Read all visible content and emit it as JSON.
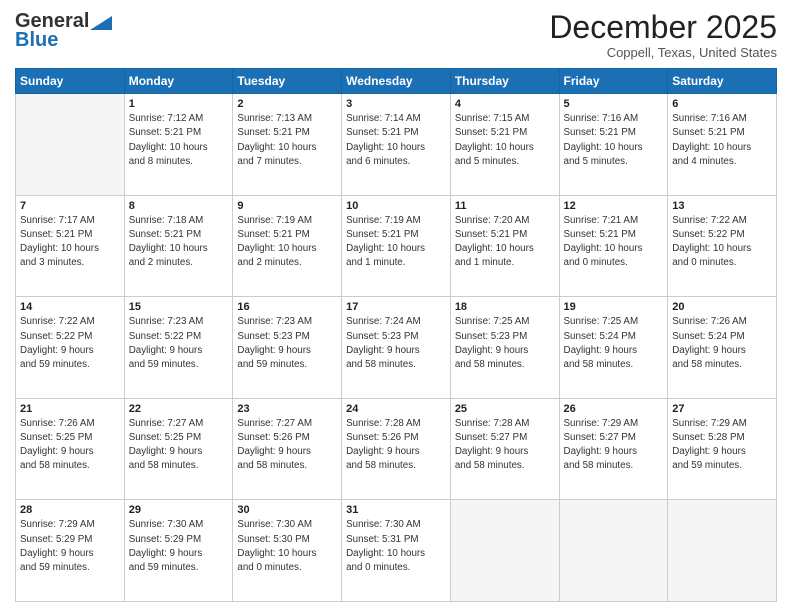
{
  "header": {
    "logo_general": "General",
    "logo_blue": "Blue",
    "month": "December 2025",
    "location": "Coppell, Texas, United States"
  },
  "days_of_week": [
    "Sunday",
    "Monday",
    "Tuesday",
    "Wednesday",
    "Thursday",
    "Friday",
    "Saturday"
  ],
  "weeks": [
    [
      {
        "day": "",
        "empty": true
      },
      {
        "day": "1",
        "rise": "7:12 AM",
        "set": "5:21 PM",
        "hours": "10 hours",
        "minutes": "8 minutes"
      },
      {
        "day": "2",
        "rise": "7:13 AM",
        "set": "5:21 PM",
        "hours": "10 hours",
        "minutes": "7 minutes"
      },
      {
        "day": "3",
        "rise": "7:14 AM",
        "set": "5:21 PM",
        "hours": "10 hours",
        "minutes": "6 minutes"
      },
      {
        "day": "4",
        "rise": "7:15 AM",
        "set": "5:21 PM",
        "hours": "10 hours",
        "minutes": "5 minutes"
      },
      {
        "day": "5",
        "rise": "7:16 AM",
        "set": "5:21 PM",
        "hours": "10 hours",
        "minutes": "5 minutes"
      },
      {
        "day": "6",
        "rise": "7:16 AM",
        "set": "5:21 PM",
        "hours": "10 hours",
        "minutes": "4 minutes"
      }
    ],
    [
      {
        "day": "7",
        "rise": "7:17 AM",
        "set": "5:21 PM",
        "hours": "10 hours",
        "minutes": "3 minutes"
      },
      {
        "day": "8",
        "rise": "7:18 AM",
        "set": "5:21 PM",
        "hours": "10 hours",
        "minutes": "2 minutes"
      },
      {
        "day": "9",
        "rise": "7:19 AM",
        "set": "5:21 PM",
        "hours": "10 hours",
        "minutes": "2 minutes"
      },
      {
        "day": "10",
        "rise": "7:19 AM",
        "set": "5:21 PM",
        "hours": "10 hours",
        "minutes": "1 minute"
      },
      {
        "day": "11",
        "rise": "7:20 AM",
        "set": "5:21 PM",
        "hours": "10 hours",
        "minutes": "1 minute"
      },
      {
        "day": "12",
        "rise": "7:21 AM",
        "set": "5:21 PM",
        "hours": "10 hours",
        "minutes": "0 minutes"
      },
      {
        "day": "13",
        "rise": "7:22 AM",
        "set": "5:22 PM",
        "hours": "10 hours",
        "minutes": "0 minutes"
      }
    ],
    [
      {
        "day": "14",
        "rise": "7:22 AM",
        "set": "5:22 PM",
        "hours": "9 hours",
        "minutes": "59 minutes"
      },
      {
        "day": "15",
        "rise": "7:23 AM",
        "set": "5:22 PM",
        "hours": "9 hours",
        "minutes": "59 minutes"
      },
      {
        "day": "16",
        "rise": "7:23 AM",
        "set": "5:23 PM",
        "hours": "9 hours",
        "minutes": "59 minutes"
      },
      {
        "day": "17",
        "rise": "7:24 AM",
        "set": "5:23 PM",
        "hours": "9 hours",
        "minutes": "58 minutes"
      },
      {
        "day": "18",
        "rise": "7:25 AM",
        "set": "5:23 PM",
        "hours": "9 hours",
        "minutes": "58 minutes"
      },
      {
        "day": "19",
        "rise": "7:25 AM",
        "set": "5:24 PM",
        "hours": "9 hours",
        "minutes": "58 minutes"
      },
      {
        "day": "20",
        "rise": "7:26 AM",
        "set": "5:24 PM",
        "hours": "9 hours",
        "minutes": "58 minutes"
      }
    ],
    [
      {
        "day": "21",
        "rise": "7:26 AM",
        "set": "5:25 PM",
        "hours": "9 hours",
        "minutes": "58 minutes"
      },
      {
        "day": "22",
        "rise": "7:27 AM",
        "set": "5:25 PM",
        "hours": "9 hours",
        "minutes": "58 minutes"
      },
      {
        "day": "23",
        "rise": "7:27 AM",
        "set": "5:26 PM",
        "hours": "9 hours",
        "minutes": "58 minutes"
      },
      {
        "day": "24",
        "rise": "7:28 AM",
        "set": "5:26 PM",
        "hours": "9 hours",
        "minutes": "58 minutes"
      },
      {
        "day": "25",
        "rise": "7:28 AM",
        "set": "5:27 PM",
        "hours": "9 hours",
        "minutes": "58 minutes"
      },
      {
        "day": "26",
        "rise": "7:29 AM",
        "set": "5:27 PM",
        "hours": "9 hours",
        "minutes": "58 minutes"
      },
      {
        "day": "27",
        "rise": "7:29 AM",
        "set": "5:28 PM",
        "hours": "9 hours",
        "minutes": "59 minutes"
      }
    ],
    [
      {
        "day": "28",
        "rise": "7:29 AM",
        "set": "5:29 PM",
        "hours": "9 hours",
        "minutes": "59 minutes"
      },
      {
        "day": "29",
        "rise": "7:30 AM",
        "set": "5:29 PM",
        "hours": "9 hours",
        "minutes": "59 minutes"
      },
      {
        "day": "30",
        "rise": "7:30 AM",
        "set": "5:30 PM",
        "hours": "10 hours",
        "minutes": "0 minutes"
      },
      {
        "day": "31",
        "rise": "7:30 AM",
        "set": "5:31 PM",
        "hours": "10 hours",
        "minutes": "0 minutes"
      },
      {
        "day": "",
        "empty": true
      },
      {
        "day": "",
        "empty": true
      },
      {
        "day": "",
        "empty": true
      }
    ]
  ]
}
